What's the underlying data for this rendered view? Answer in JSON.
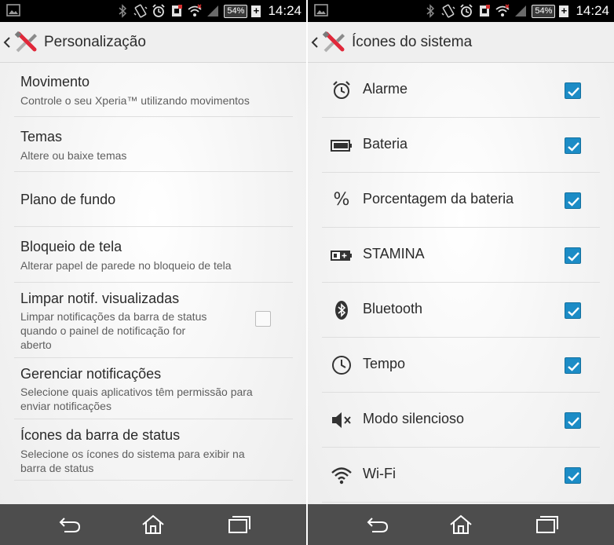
{
  "status_bar": {
    "battery_percent": "54%",
    "time": "14:24",
    "icons": [
      "image-icon",
      "bluetooth-icon",
      "vibrate-icon",
      "alarm-icon",
      "nfc-icon",
      "wifi-icon",
      "signal-icon",
      "battery-icon",
      "plus-icon"
    ]
  },
  "left_screen": {
    "title": "Personalização",
    "items": [
      {
        "title": "Movimento",
        "summary": "Controle o seu Xperia™ utilizando movimentos"
      },
      {
        "title": "Temas",
        "summary": "Altere ou baixe temas"
      },
      {
        "title": "Plano de fundo",
        "summary": ""
      },
      {
        "title": "Bloqueio de tela",
        "summary": "Alterar papel de parede no bloqueio de tela"
      },
      {
        "title": "Limpar notif. visualizadas",
        "summary_lines": [
          "Limpar notificações da barra de status",
          "quando o painel de notificação for",
          "aberto"
        ],
        "checked": false
      },
      {
        "title": "Gerenciar notificações",
        "summary_lines": [
          "Selecione quais aplicativos têm permissão para",
          "enviar notificações"
        ]
      },
      {
        "title": "Ícones da barra de status",
        "summary_lines": [
          "Selecione os ícones do sistema para exibir na",
          "barra de status"
        ]
      }
    ]
  },
  "right_screen": {
    "title": "Ícones do sistema",
    "items": [
      {
        "label": "Alarme",
        "icon": "alarm-clock-icon",
        "checked": true
      },
      {
        "label": "Bateria",
        "icon": "battery-icon",
        "checked": true
      },
      {
        "label": "Porcentagem da bateria",
        "icon": "percent-icon",
        "glyph": "%",
        "checked": true
      },
      {
        "label": "STAMINA",
        "icon": "stamina-battery-icon",
        "checked": true
      },
      {
        "label": "Bluetooth",
        "icon": "bluetooth-icon",
        "checked": true
      },
      {
        "label": "Tempo",
        "icon": "clock-icon",
        "checked": true
      },
      {
        "label": "Modo silencioso",
        "icon": "speaker-mute-icon",
        "checked": true
      },
      {
        "label": "Wi-Fi",
        "icon": "wifi-icon",
        "checked": true
      }
    ]
  },
  "colors": {
    "checkbox_checked": "#1c8cc6",
    "status_bar": "#000000",
    "navigation_bar": "#4d4d4d",
    "action_bar": "#efefef"
  }
}
